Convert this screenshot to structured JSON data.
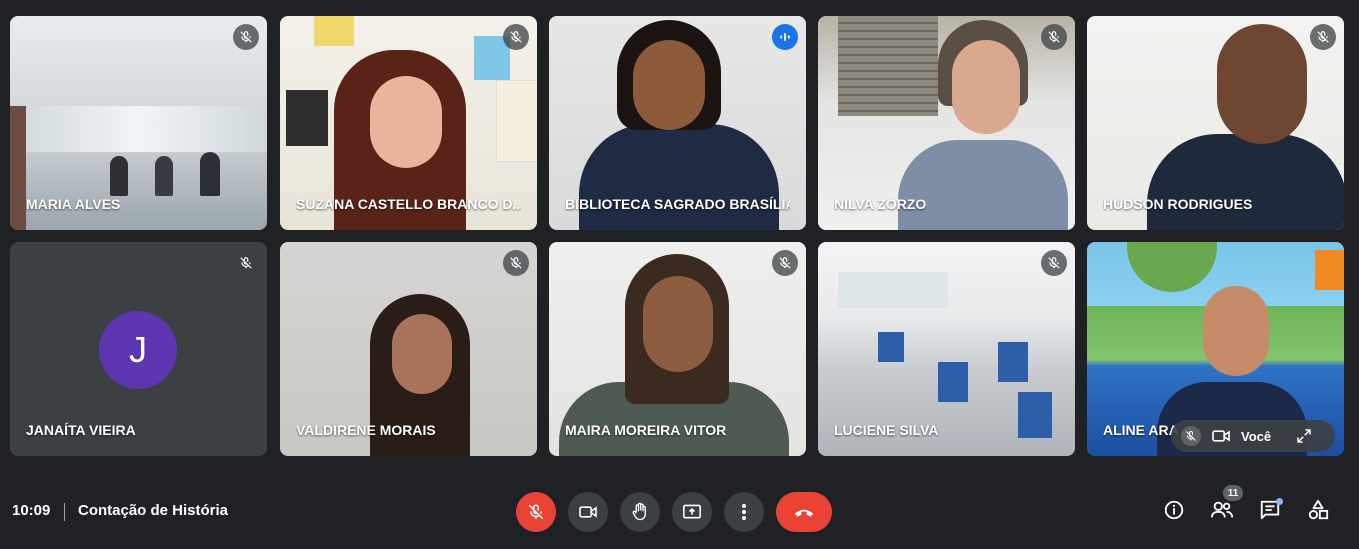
{
  "participants": [
    {
      "name": "MARIA ALVES"
    },
    {
      "name": "SUZANA CASTELLO BRANCO D..."
    },
    {
      "name": "BIBLIOTECA SAGRADO BRASÍLIA"
    },
    {
      "name": "NILVA ZORZO"
    },
    {
      "name": "HUDSON RODRIGUES"
    },
    {
      "name": "JANAÍTA VIEIRA",
      "avatar_letter": "J"
    },
    {
      "name": "VALDIRENE MORAIS"
    },
    {
      "name": "MAIRA MOREIRA VITOR"
    },
    {
      "name": "LUCIENE SILVA"
    },
    {
      "name": "ALINE ARA"
    }
  ],
  "self_tile": {
    "label": "Você"
  },
  "footer": {
    "time": "10:09",
    "meeting_title": "Contação de História",
    "participant_count": "11"
  },
  "colors": {
    "background": "#202124",
    "tile": "#3c4043",
    "end_call": "#ea4335",
    "speaking": "#1a73e8",
    "avatar": "#5e35b1"
  },
  "icons": [
    "mic-off-icon",
    "camera-icon",
    "raise-hand-icon",
    "present-icon",
    "more-icon",
    "end-call-icon",
    "info-icon",
    "people-icon",
    "chat-icon",
    "activities-icon"
  ]
}
